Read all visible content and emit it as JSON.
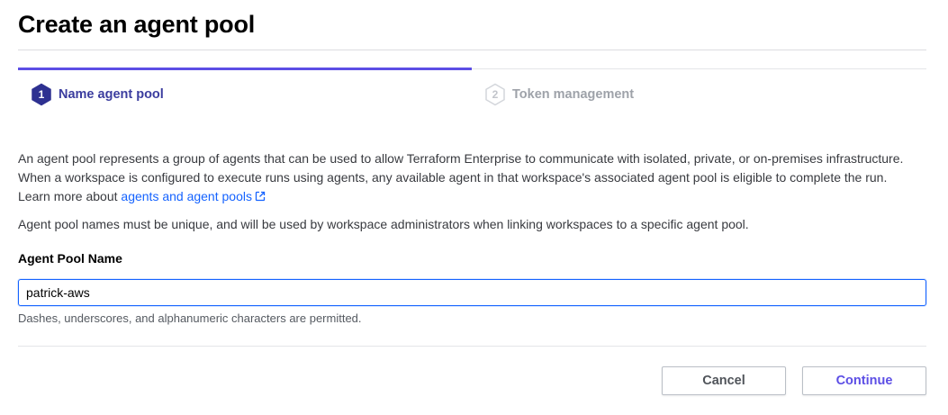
{
  "page": {
    "title": "Create an agent pool"
  },
  "stepper": {
    "steps": [
      {
        "number": "1",
        "label": "Name agent pool",
        "state": "active"
      },
      {
        "number": "2",
        "label": "Token management",
        "state": "inactive"
      }
    ],
    "colors": {
      "active": "#5c4ee5",
      "active_label": "#3b3d9f",
      "inactive": "#c2c5cb"
    }
  },
  "description": {
    "line1": "An agent pool represents a group of agents that can be used to allow Terraform Enterprise to communicate with isolated, private, or on-premises infrastructure.",
    "line2": "When a workspace is configured to execute runs using agents, any available agent in that workspace's associated agent pool is eligible to complete the run.",
    "learn_more_prefix": "Learn more about ",
    "learn_more_link": "agents and agent pools",
    "link_icon": "external-link-icon"
  },
  "note": "Agent pool names must be unique, and will be used by workspace administrators when linking workspaces to a specific agent pool.",
  "form": {
    "name_label": "Agent Pool Name",
    "name_value": "patrick-aws",
    "name_helper": "Dashes, underscores, and alphanumeric characters are permitted."
  },
  "actions": {
    "cancel_label": "Cancel",
    "continue_label": "Continue"
  }
}
